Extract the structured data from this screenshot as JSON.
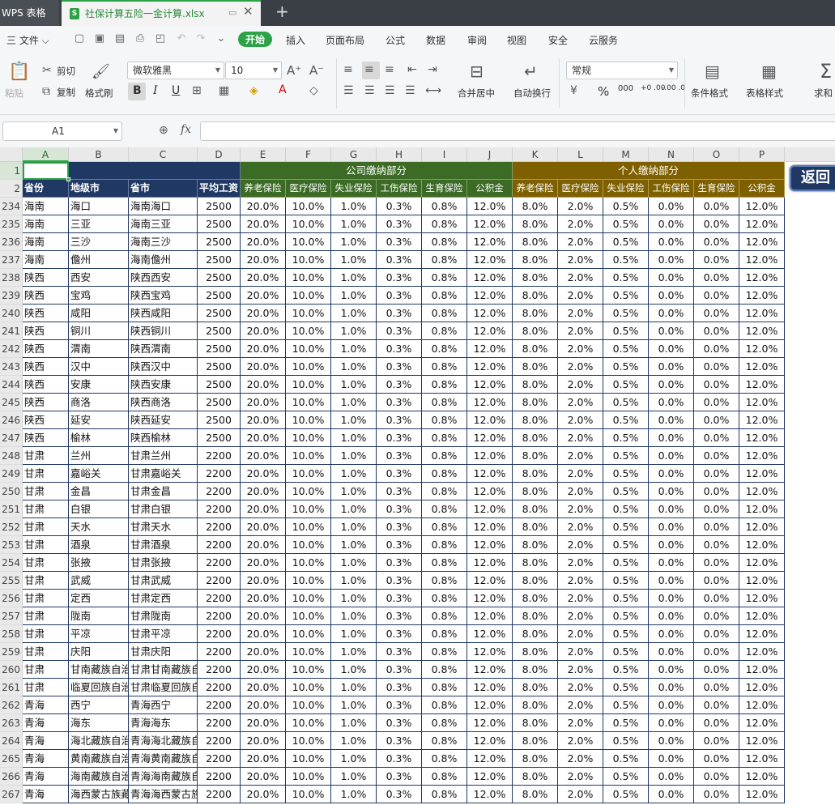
{
  "titlebar": {
    "app_tab": "WPS 表格",
    "doc_title": "社保计算五险一金计算.xlsx"
  },
  "menu": {
    "file": "三 文件 ⌵",
    "items": [
      "开始",
      "插入",
      "页面布局",
      "公式",
      "数据",
      "审阅",
      "视图",
      "安全",
      "云服务"
    ],
    "active_index": 0
  },
  "ribbon": {
    "paste": "粘贴",
    "cut": "剪切",
    "copy": "复制",
    "format_painter": "格式刷",
    "font_name": "微软雅黑",
    "font_size": "10",
    "bold": "B",
    "italic": "I",
    "underline": "U",
    "merge_center": "合并居中",
    "wrap_text": "自动换行",
    "number_format": "常规",
    "percent": "%",
    "thousands": "000",
    "inc_decimal": "+0 .00",
    "dec_decimal": "-.00 .0",
    "conditional_format": "条件格式",
    "table_style": "表格样式",
    "sum": "求和"
  },
  "formula_bar": {
    "name_box": "A1",
    "fx": "fx",
    "value": ""
  },
  "columns": [
    "A",
    "B",
    "C",
    "D",
    "E",
    "F",
    "G",
    "H",
    "I",
    "J",
    "K",
    "L",
    "M",
    "N",
    "O",
    "P"
  ],
  "header": {
    "row_numbers": [
      "1",
      "2"
    ],
    "province": "省份",
    "city": "地级市",
    "prov_city": "省市",
    "avg_wage": "平均工资",
    "company_group": "公司缴纳部分",
    "personal_group": "个人缴纳部分",
    "company_items": [
      "养老保险",
      "医疗保险",
      "失业保险",
      "工伤保险",
      "生育保险",
      "公积金"
    ],
    "personal_items": [
      "养老保险",
      "医疗保险",
      "失业保险",
      "工伤保险",
      "生育保险",
      "公积金"
    ]
  },
  "return_button": "返回",
  "rows": [
    {
      "n": "234",
      "p": "海南",
      "c": "海口",
      "pc": "海南海口",
      "w": "2500"
    },
    {
      "n": "235",
      "p": "海南",
      "c": "三亚",
      "pc": "海南三亚",
      "w": "2500"
    },
    {
      "n": "236",
      "p": "海南",
      "c": "三沙",
      "pc": "海南三沙",
      "w": "2500"
    },
    {
      "n": "237",
      "p": "海南",
      "c": "儋州",
      "pc": "海南儋州",
      "w": "2500"
    },
    {
      "n": "238",
      "p": "陕西",
      "c": "西安",
      "pc": "陕西西安",
      "w": "2500"
    },
    {
      "n": "239",
      "p": "陕西",
      "c": "宝鸡",
      "pc": "陕西宝鸡",
      "w": "2500"
    },
    {
      "n": "240",
      "p": "陕西",
      "c": "咸阳",
      "pc": "陕西咸阳",
      "w": "2500"
    },
    {
      "n": "241",
      "p": "陕西",
      "c": "铜川",
      "pc": "陕西铜川",
      "w": "2500"
    },
    {
      "n": "242",
      "p": "陕西",
      "c": "渭南",
      "pc": "陕西渭南",
      "w": "2500"
    },
    {
      "n": "243",
      "p": "陕西",
      "c": "汉中",
      "pc": "陕西汉中",
      "w": "2500"
    },
    {
      "n": "244",
      "p": "陕西",
      "c": "安康",
      "pc": "陕西安康",
      "w": "2500"
    },
    {
      "n": "245",
      "p": "陕西",
      "c": "商洛",
      "pc": "陕西商洛",
      "w": "2500"
    },
    {
      "n": "246",
      "p": "陕西",
      "c": "延安",
      "pc": "陕西延安",
      "w": "2500"
    },
    {
      "n": "247",
      "p": "陕西",
      "c": "榆林",
      "pc": "陕西榆林",
      "w": "2500"
    },
    {
      "n": "248",
      "p": "甘肃",
      "c": "兰州",
      "pc": "甘肃兰州",
      "w": "2200"
    },
    {
      "n": "249",
      "p": "甘肃",
      "c": "嘉峪关",
      "pc": "甘肃嘉峪关",
      "w": "2200"
    },
    {
      "n": "250",
      "p": "甘肃",
      "c": "金昌",
      "pc": "甘肃金昌",
      "w": "2200"
    },
    {
      "n": "251",
      "p": "甘肃",
      "c": "白银",
      "pc": "甘肃白银",
      "w": "2200"
    },
    {
      "n": "252",
      "p": "甘肃",
      "c": "天水",
      "pc": "甘肃天水",
      "w": "2200"
    },
    {
      "n": "253",
      "p": "甘肃",
      "c": "酒泉",
      "pc": "甘肃酒泉",
      "w": "2200"
    },
    {
      "n": "254",
      "p": "甘肃",
      "c": "张掖",
      "pc": "甘肃张掖",
      "w": "2200"
    },
    {
      "n": "255",
      "p": "甘肃",
      "c": "武威",
      "pc": "甘肃武威",
      "w": "2200"
    },
    {
      "n": "256",
      "p": "甘肃",
      "c": "定西",
      "pc": "甘肃定西",
      "w": "2200"
    },
    {
      "n": "257",
      "p": "甘肃",
      "c": "陇南",
      "pc": "甘肃陇南",
      "w": "2200"
    },
    {
      "n": "258",
      "p": "甘肃",
      "c": "平凉",
      "pc": "甘肃平凉",
      "w": "2200"
    },
    {
      "n": "259",
      "p": "甘肃",
      "c": "庆阳",
      "pc": "甘肃庆阳",
      "w": "2200"
    },
    {
      "n": "260",
      "p": "甘肃",
      "c": "甘南藏族自治",
      "pc": "甘肃甘南藏族自",
      "w": "2200"
    },
    {
      "n": "261",
      "p": "甘肃",
      "c": "临夏回族自治",
      "pc": "甘肃临夏回族自",
      "w": "2200"
    },
    {
      "n": "262",
      "p": "青海",
      "c": "西宁",
      "pc": "青海西宁",
      "w": "2200"
    },
    {
      "n": "263",
      "p": "青海",
      "c": "海东",
      "pc": "青海海东",
      "w": "2200"
    },
    {
      "n": "264",
      "p": "青海",
      "c": "海北藏族自治",
      "pc": "青海海北藏族自",
      "w": "2200"
    },
    {
      "n": "265",
      "p": "青海",
      "c": "黄南藏族自治",
      "pc": "青海黄南藏族自",
      "w": "2200"
    },
    {
      "n": "266",
      "p": "青海",
      "c": "海南藏族自治",
      "pc": "青海海南藏族自",
      "w": "2200"
    },
    {
      "n": "267",
      "p": "青海",
      "c": "海西蒙古族藏",
      "pc": "青海海西蒙古族",
      "w": "2200"
    }
  ],
  "rates": {
    "company": [
      "20.0%",
      "10.0%",
      "1.0%",
      "0.3%",
      "0.8%",
      "12.0%"
    ],
    "personal": [
      "8.0%",
      "2.0%",
      "0.5%",
      "0.0%",
      "0.0%",
      "12.0%"
    ]
  },
  "colors": {
    "accent": "#2ba245",
    "header_navy": "#1f3864",
    "header_green": "#3b6b24",
    "header_gold": "#7f6000"
  }
}
